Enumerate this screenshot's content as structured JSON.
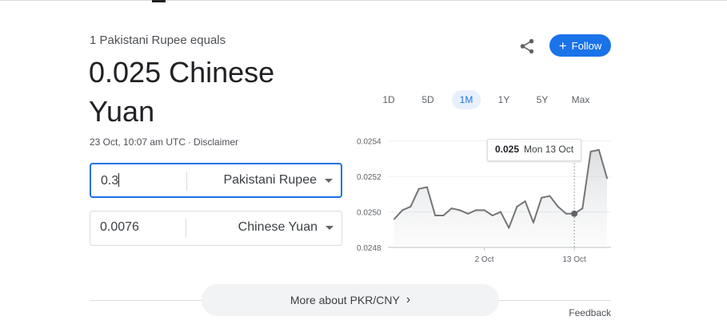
{
  "header": {
    "subtitle": "1 Pakistani Rupee equals",
    "result": "0.025 Chinese Yuan",
    "timestamp": "23 Oct, 10:07 am UTC",
    "separator": "·",
    "disclaimer": "Disclaimer"
  },
  "actions": {
    "share_icon": "share-icon",
    "follow_plus": "+",
    "follow_label": "Follow"
  },
  "converter": {
    "from": {
      "amount": "0.3",
      "currency": "Pakistani Rupee"
    },
    "to": {
      "amount": "0.0076",
      "currency": "Chinese Yuan"
    }
  },
  "ranges": [
    "1D",
    "5D",
    "1M",
    "1Y",
    "5Y",
    "Max"
  ],
  "selected_range": "1M",
  "tooltip": {
    "value": "0.025",
    "date": "Mon 13 Oct"
  },
  "colors": {
    "accent": "#1a73e8",
    "line": "#757575",
    "selected_tab_bg": "#e8f0fe"
  },
  "chart_data": {
    "type": "area",
    "y_ticks": [
      "0.0254",
      "0.0252",
      "0.0250",
      "0.0248"
    ],
    "ylim": [
      0.0248,
      0.02543
    ],
    "x_ticks": [
      {
        "label": "2 Oct",
        "index": 11
      },
      {
        "label": "13 Oct",
        "index": 22
      }
    ],
    "hover_index": 22,
    "values": [
      0.02496,
      0.02501,
      0.02503,
      0.02513,
      0.02514,
      0.02498,
      0.02498,
      0.02502,
      0.02501,
      0.02499,
      0.02501,
      0.02501,
      0.02498,
      0.025,
      0.02491,
      0.02503,
      0.02506,
      0.02494,
      0.02508,
      0.02509,
      0.02503,
      0.02499,
      0.02499,
      0.02502,
      0.02534,
      0.02535,
      0.02519
    ]
  },
  "footer": {
    "more_label": "More about PKR/CNY",
    "more_chevron": "›",
    "feedback": "Feedback"
  }
}
